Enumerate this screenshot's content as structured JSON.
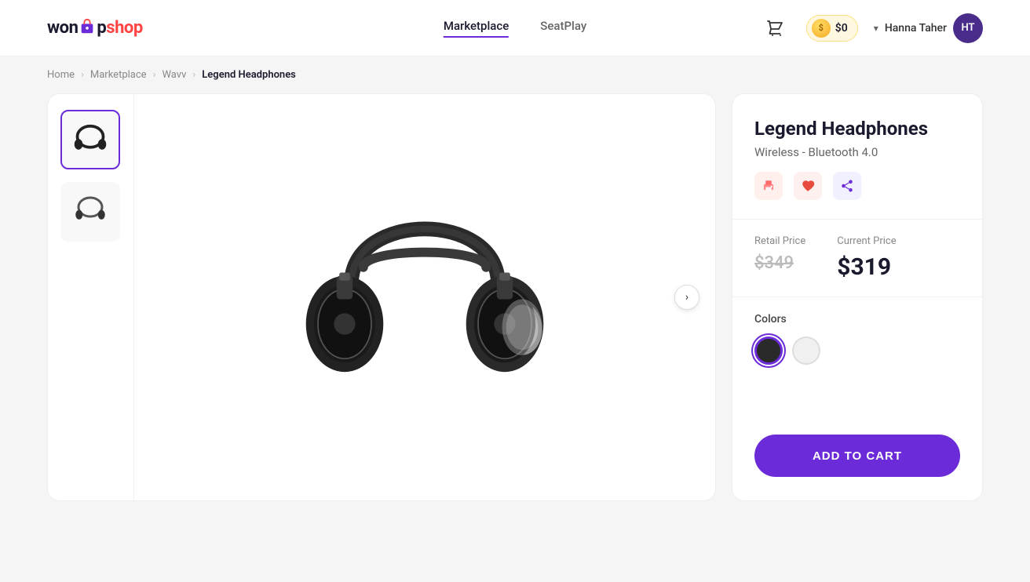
{
  "brand": {
    "logo_won": "won",
    "logo_up": "Up",
    "logo_shop": "shop"
  },
  "nav": {
    "items": [
      {
        "id": "marketplace",
        "label": "Marketplace",
        "active": true
      },
      {
        "id": "seatplay",
        "label": "SeatPlay",
        "active": false
      }
    ]
  },
  "header": {
    "cart_label": "cart",
    "coin_amount": "$0",
    "user_name": "Hanna Taher",
    "user_initials": "HT",
    "chevron": "▾"
  },
  "breadcrumb": {
    "home": "Home",
    "marketplace": "Marketplace",
    "brand": "Wavv",
    "product": "Legend Headphones",
    "sep": "›"
  },
  "product": {
    "title": "Legend Headphones",
    "subtitle": "Wireless - Bluetooth 4.0",
    "retail_price_label": "Retail Price",
    "current_price_label": "Current Price",
    "retail_price": "$349",
    "current_price": "$319",
    "colors_label": "Colors",
    "add_to_cart": "ADD TO CART",
    "colors": [
      "black",
      "white"
    ],
    "next_arrow": "›"
  }
}
